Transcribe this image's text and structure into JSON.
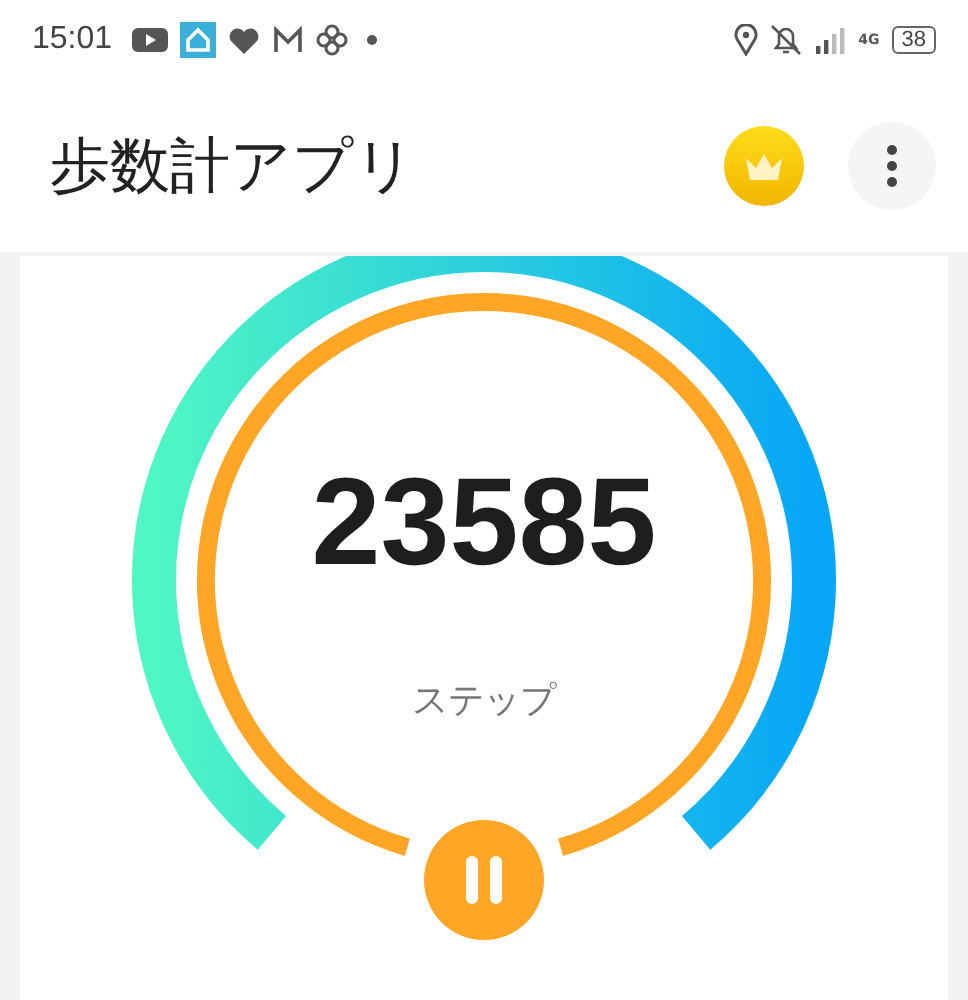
{
  "status_bar": {
    "time": "15:01",
    "network": "4G",
    "battery": "38"
  },
  "app_bar": {
    "title": "歩数計アプリ"
  },
  "counter": {
    "count": "23585",
    "unit": "ステップ",
    "paused": false
  }
}
